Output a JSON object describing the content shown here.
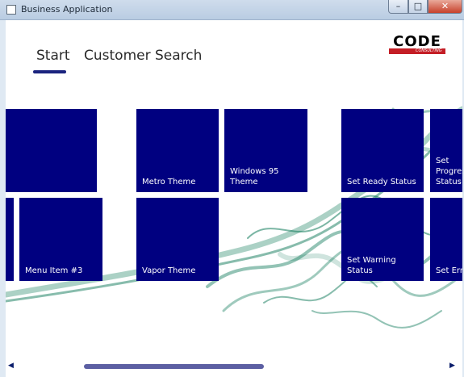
{
  "window": {
    "title": "Business Application",
    "minimize_glyph": "–",
    "maximize_glyph": "□",
    "close_glyph": "✕"
  },
  "tabs": [
    {
      "label": "Start",
      "selected": true
    },
    {
      "label": "Customer Search",
      "selected": false
    }
  ],
  "logo": {
    "text": "CODE",
    "subtext": "CONSULTING",
    "accent_color": "#c41e26"
  },
  "tiles": [
    {
      "label": ""
    },
    {
      "label": "Metro Theme"
    },
    {
      "label": "Windows 95 Theme"
    },
    {
      "label": "Set Ready Status"
    },
    {
      "label": "Set Progress Status"
    },
    {
      "label": ""
    },
    {
      "label": "Menu Item #3"
    },
    {
      "label": "Vapor Theme"
    },
    {
      "label": "Set Warning Status"
    },
    {
      "label": "Set Error Status"
    }
  ],
  "theme": {
    "tile_color": "#000080",
    "accent": "#1a237e",
    "smoke_color": "#0f7a5a"
  },
  "scrollbar": {
    "left_glyph": "◀",
    "right_glyph": "▶"
  }
}
